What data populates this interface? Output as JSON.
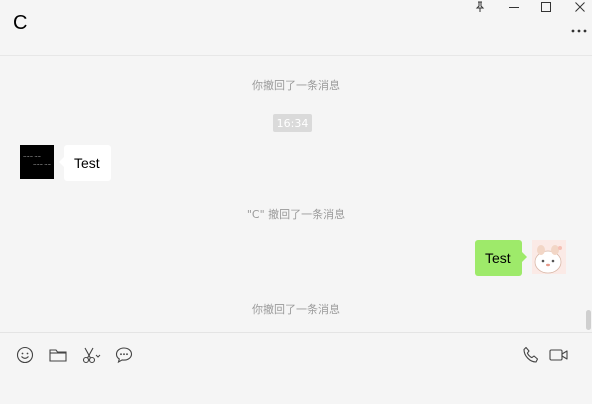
{
  "header": {
    "contact_name": "C"
  },
  "chat": {
    "messages": [
      {
        "kind": "system",
        "text": "你撤回了一条消息"
      },
      {
        "kind": "time",
        "text": "16:34"
      },
      {
        "kind": "incoming",
        "text": "Test"
      },
      {
        "kind": "system",
        "text": "\"C\" 撤回了一条消息"
      },
      {
        "kind": "outgoing",
        "text": "Test"
      },
      {
        "kind": "system",
        "text": "你撤回了一条消息"
      }
    ]
  },
  "colors": {
    "outgoing_bubble": "#9eea6a",
    "incoming_bubble": "#ffffff",
    "background": "#f5f5f5"
  },
  "icons": {
    "window": [
      "pin-icon",
      "minimize-icon",
      "maximize-icon",
      "close-icon"
    ],
    "header": [
      "more-icon"
    ],
    "toolbar_left": [
      "emoji-icon",
      "folder-icon",
      "screenshot-icon",
      "chat-history-icon"
    ],
    "toolbar_right": [
      "voice-call-icon",
      "video-call-icon"
    ]
  }
}
